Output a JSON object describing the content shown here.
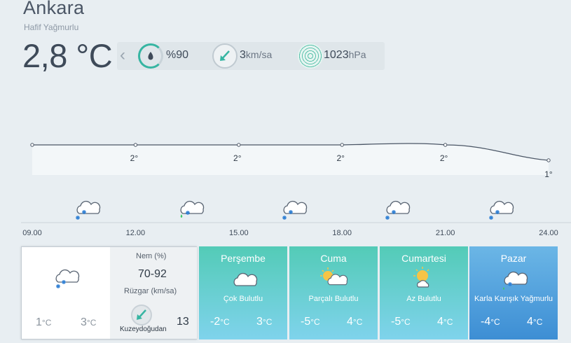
{
  "current": {
    "city": "Ankara",
    "condition": "Hafif Yağmurlu",
    "temperature": "2,8 °C",
    "humidity": "%90",
    "wind_value": "3",
    "wind_unit": "km/sa",
    "pressure_value": "1023",
    "pressure_unit": "hPa"
  },
  "hourly": {
    "times": [
      "09.00",
      "12.00",
      "15.00",
      "18.00",
      "21.00",
      "24.00"
    ],
    "temperatures": [
      2,
      2,
      2,
      2,
      2,
      1
    ],
    "temp_labels": [
      "2°",
      "2°",
      "2°",
      "2°",
      "1°"
    ],
    "icons": [
      "cloud-snow-icon",
      "cloud-rain-snow-icon",
      "cloud-snow-icon",
      "cloud-snow-icon",
      "cloud-snow-icon"
    ]
  },
  "today": {
    "humidity_label": "Nem (%)",
    "humidity_value": "70-92",
    "wind_label": "Rüzgar (km/sa)",
    "wind_direction": "Kuzeydoğudan",
    "wind_speed": "13",
    "low": "1",
    "high": "3",
    "unit": "°C",
    "icon": "cloud-snow-icon"
  },
  "forecast": [
    {
      "day": "Perşembe",
      "desc": "Çok Bulutlu",
      "low": "-2",
      "high": "3",
      "unit": "°C",
      "icon": "cloud-icon"
    },
    {
      "day": "Cuma",
      "desc": "Parçalı Bulutlu",
      "low": "-5",
      "high": "4",
      "unit": "°C",
      "icon": "sun-cloud-icon"
    },
    {
      "day": "Cumartesi",
      "desc": "Az Bulutlu",
      "low": "-5",
      "high": "4",
      "unit": "°C",
      "icon": "sun-small-cloud-icon"
    },
    {
      "day": "Pazar",
      "desc": "Karla Karışık Yağmurlu",
      "low": "-4",
      "high": "4",
      "unit": "°C",
      "icon": "cloud-rain-snow-icon"
    }
  ],
  "colors": {
    "accent": "#36b5a2",
    "card_teal": "#53cbb7",
    "card_blue": "#3d8ed4"
  }
}
